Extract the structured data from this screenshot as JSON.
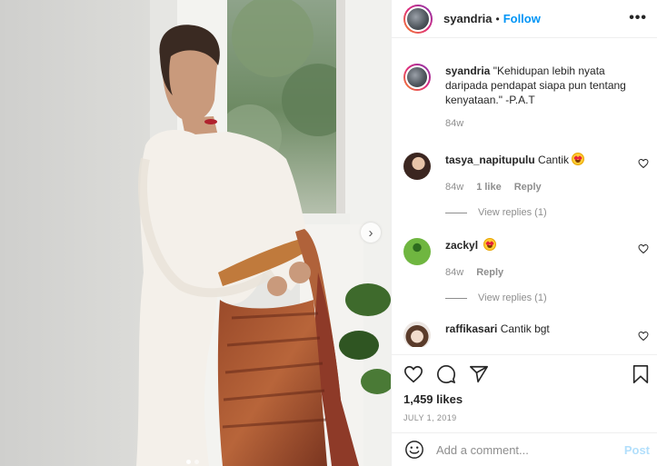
{
  "post": {
    "username": "syandria",
    "separator": "•",
    "follow_label": "Follow",
    "more_label": "•••",
    "caption_user": "syandria",
    "caption_text": "\"Kehidupan lebih nyata daripada pendapat siapa pun tentang kenyataan.\" -P.A.T",
    "caption_age": "84w",
    "likes": "1,459 likes",
    "date": "JULY 1, 2019",
    "carousel": {
      "count": 2,
      "active_index": 0
    }
  },
  "comments": [
    {
      "user": "tasya_napitupulu",
      "text": "Cantik",
      "emoji": "heart-eyes-emoji",
      "age": "84w",
      "likes": "1 like",
      "reply_label": "Reply",
      "replies_label": "View replies (1)"
    },
    {
      "user": "zackyl",
      "text": "",
      "emoji": "heart-eyes-emoji",
      "age": "84w",
      "reply_label": "Reply",
      "replies_label": "View replies (1)"
    },
    {
      "user": "raffikasari",
      "text": "Cantik bgt"
    }
  ],
  "add_comment": {
    "placeholder": "Add a comment...",
    "post_label": "Post"
  },
  "icons": {
    "like": "heart-icon",
    "comment": "comment-icon",
    "share": "paper-plane-icon",
    "save": "bookmark-icon",
    "emoji": "smiley-icon",
    "next": "chevron-right-icon",
    "more": "more-icon"
  },
  "colors": {
    "accent": "#0095f6",
    "post_disabled": "#b2dffc",
    "muted": "#8e8e8e",
    "text": "#262626"
  }
}
